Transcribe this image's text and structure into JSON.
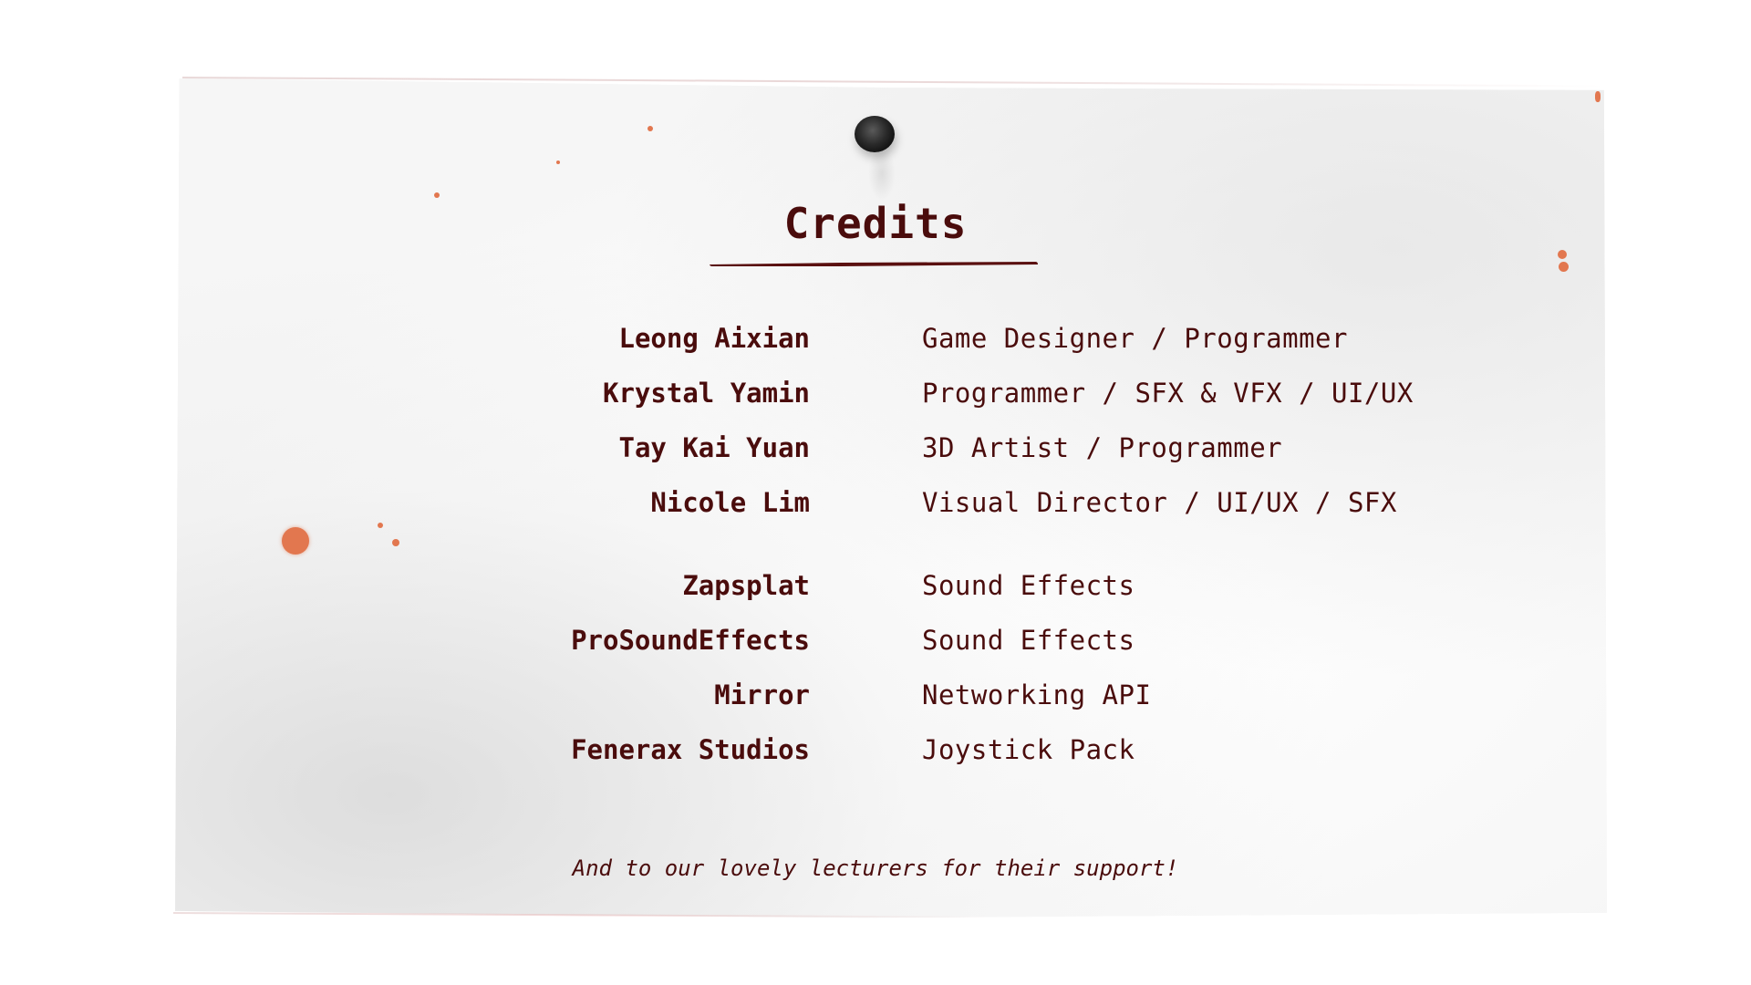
{
  "screen": {
    "title": "Credits",
    "credits": [
      {
        "name": "Leong Aixian",
        "role": "Game Designer / Programmer"
      },
      {
        "name": "Krystal Yamin",
        "role": "Programmer / SFX & VFX / UI/UX"
      },
      {
        "name": "Tay Kai Yuan",
        "role": "3D Artist / Programmer"
      },
      {
        "name": "Nicole Lim",
        "role": "Visual Director / UI/UX / SFX"
      },
      {
        "name": "Zapsplat",
        "role": "Sound Effects"
      },
      {
        "name": "ProSoundEffects",
        "role": "Sound Effects"
      },
      {
        "name": "Mirror",
        "role": "Networking API"
      },
      {
        "name": "Fenerax Studios",
        "role": "Joystick Pack"
      }
    ],
    "footer": "And to our lovely lecturers for their support!"
  },
  "colors": {
    "text": "#4a0c0c",
    "paper": "#f4f4f4",
    "splatter": "#e2774f",
    "pin": "#2a2a2a"
  },
  "icons": {
    "pin": "pushpin-icon",
    "splatter": "paint-splatter"
  }
}
